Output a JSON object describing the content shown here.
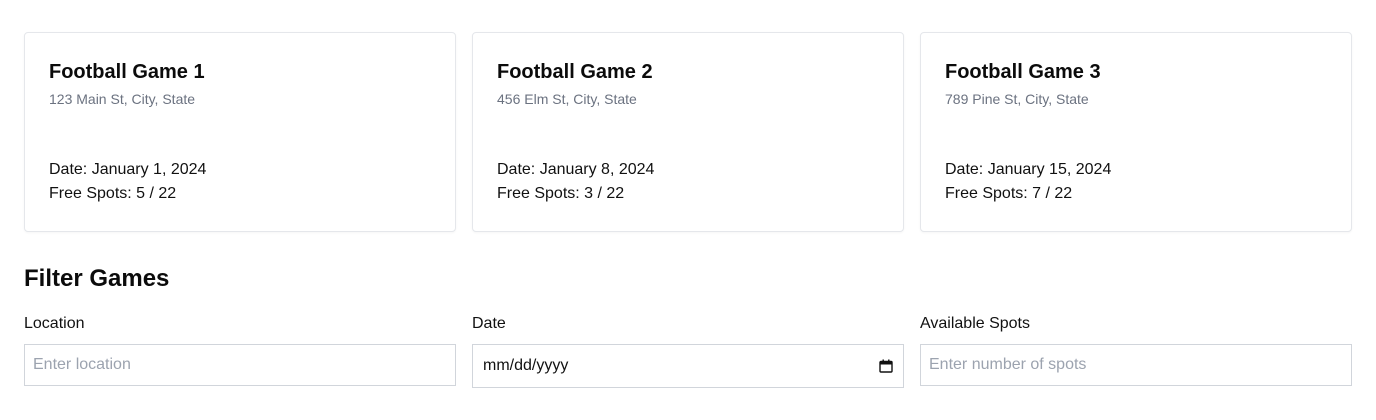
{
  "games": [
    {
      "title": "Football Game 1",
      "address": "123 Main St, City, State",
      "date": "Date: January 1, 2024",
      "spots": "Free Spots: 5 / 22"
    },
    {
      "title": "Football Game 2",
      "address": "456 Elm St, City, State",
      "date": "Date: January 8, 2024",
      "spots": "Free Spots: 3 / 22"
    },
    {
      "title": "Football Game 3",
      "address": "789 Pine St, City, State",
      "date": "Date: January 15, 2024",
      "spots": "Free Spots: 7 / 22"
    }
  ],
  "filter": {
    "title": "Filter Games",
    "location": {
      "label": "Location",
      "value": "",
      "placeholder": "Enter location"
    },
    "date": {
      "label": "Date",
      "value": "mm/dd/yyyy",
      "icon": "calendar-icon"
    },
    "spots": {
      "label": "Available Spots",
      "value": "",
      "placeholder": "Enter number of spots"
    }
  }
}
